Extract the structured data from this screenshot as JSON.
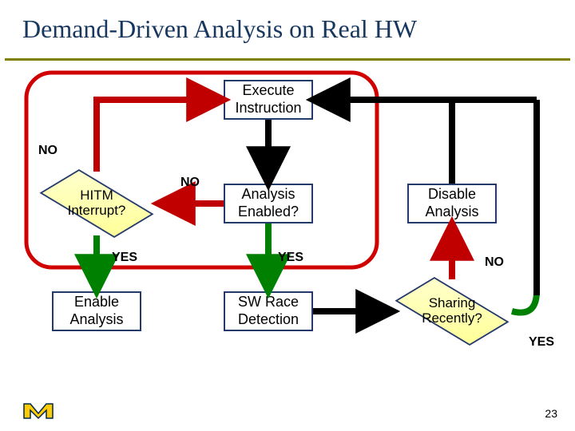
{
  "title": "Demand-Driven Analysis on Real HW",
  "nodes": {
    "execute": "Execute\nInstruction",
    "hitm": "HITM\nInterrupt?",
    "analysis_enabled": "Analysis\nEnabled?",
    "disable": "Disable\nAnalysis",
    "enable": "Enable\nAnalysis",
    "sw_race": "SW Race\nDetection",
    "sharing": "Sharing\nRecently?"
  },
  "labels": {
    "no1": "NO",
    "no2": "NO",
    "no3": "NO",
    "yes1": "YES",
    "yes2": "YES",
    "yes3": "YES"
  },
  "page_number": "23"
}
